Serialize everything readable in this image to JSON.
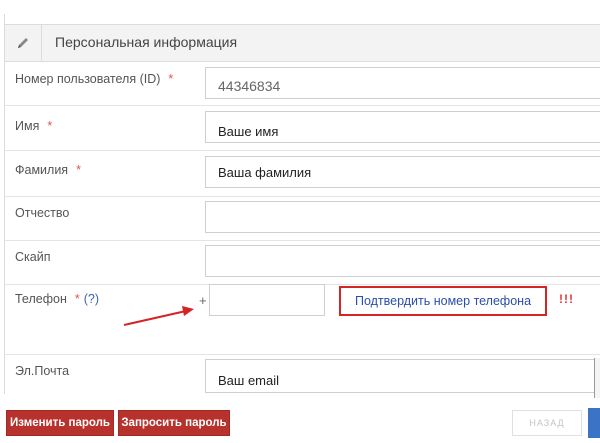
{
  "panel": {
    "title": "Персональная информация"
  },
  "fields": {
    "user_id": {
      "label": "Номер пользователя (ID)",
      "required": "*",
      "value": "44346834"
    },
    "first_name": {
      "label": "Имя",
      "required": "*",
      "value": "Ваше имя"
    },
    "last_name": {
      "label": "Фамилия",
      "required": "*",
      "value": "Ваша фамилия"
    },
    "middle_name": {
      "label": "Отчество",
      "value": ""
    },
    "skype": {
      "label": "Скайп",
      "value": ""
    },
    "phone": {
      "label": "Телефон",
      "required": "*",
      "help": "(?)",
      "prefix": "+",
      "value": "",
      "confirm_label": "Подтвердить номер телефона",
      "alert": "!!!"
    },
    "email": {
      "label": "Эл.Почта",
      "value": "Ваш email"
    }
  },
  "buttons": {
    "change_password": "Изменить пароль",
    "request_password": "Запросить пароль",
    "back": "НАЗАД"
  },
  "colors": {
    "primary_red": "#b8322d",
    "highlight_red": "#d42424",
    "link_blue": "#2a4fa8",
    "accent_blue": "#3b74c7"
  }
}
